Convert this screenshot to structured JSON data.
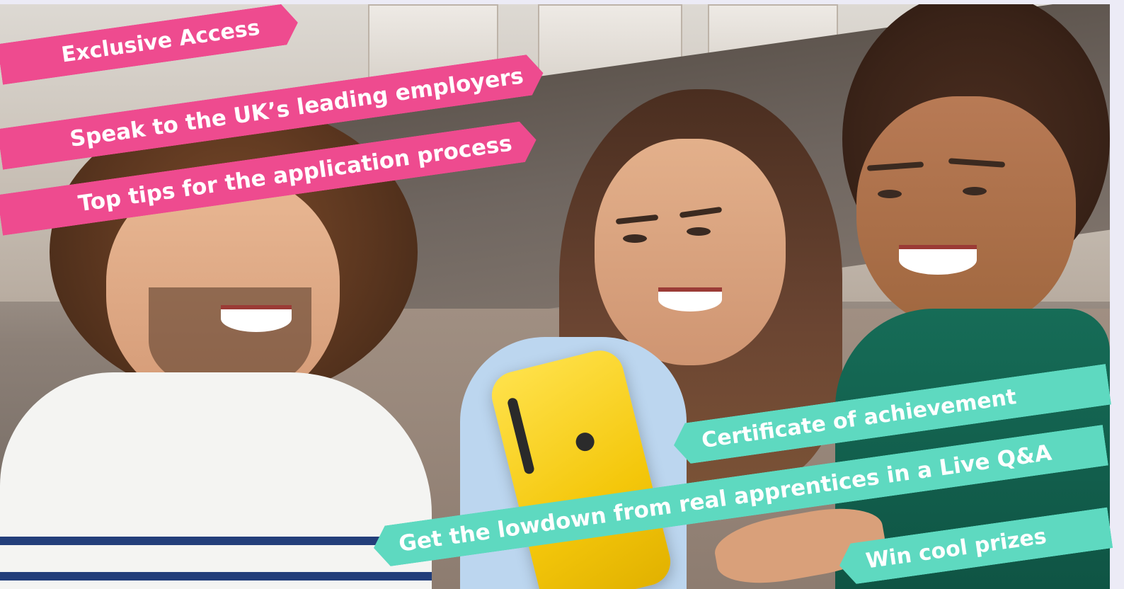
{
  "pink_banners": [
    "Exclusive Access",
    "Speak to the UK’s leading employers",
    "Top tips for the application process"
  ],
  "teal_banners": [
    "Certificate of achievement",
    "Get the lowdown from real apprentices in a Live Q&A",
    "Win cool prizes"
  ],
  "colors": {
    "pink": "#ee4b8f",
    "teal": "#5ed9c0",
    "phone": "#f4c70b"
  }
}
